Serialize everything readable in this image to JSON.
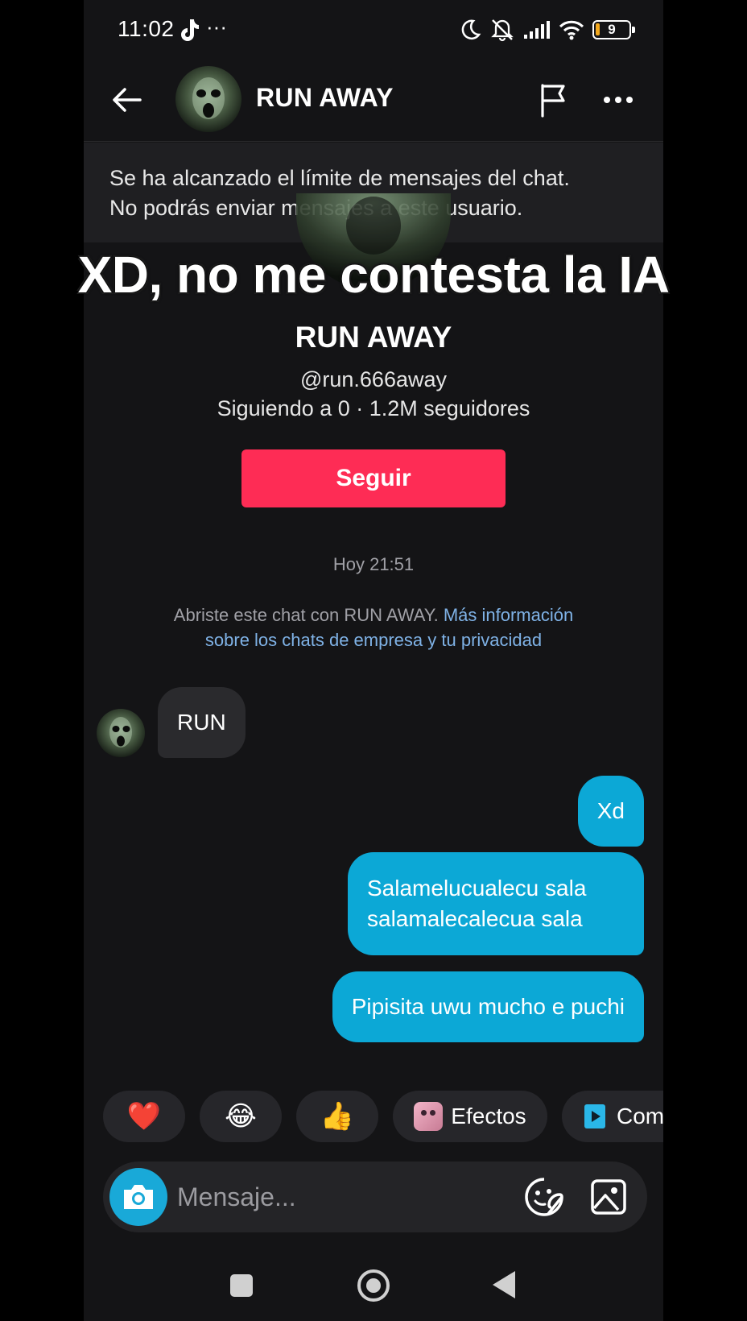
{
  "status_bar": {
    "time": "11:02",
    "dots": "···",
    "battery": "9",
    "icons": [
      "moon-icon",
      "mute-icon",
      "signal-icon",
      "wifi-icon",
      "battery-icon"
    ]
  },
  "header": {
    "title": "RUN AWAY"
  },
  "banner": {
    "line1": "Se ha alcanzado el límite de mensajes del chat.",
    "line2": "No podrás enviar mensajes a este usuario."
  },
  "profile": {
    "name": "RUN AWAY",
    "handle": "@run.666away",
    "stats": "Siguiendo a 0 · 1.2M seguidores",
    "follow_label": "Seguir"
  },
  "chat": {
    "timestamp": "Hoy 21:51",
    "info_prefix": "Abriste este chat con RUN AWAY. ",
    "info_link": "Más información sobre los chats de empresa y tu privacidad",
    "messages": [
      {
        "from": "them",
        "text": "RUN"
      },
      {
        "from": "me",
        "text": "Xd"
      },
      {
        "from": "me",
        "text": "Salamelucualecu sala salamalecalecua sala"
      },
      {
        "from": "me",
        "text": "Pipisita uwu mucho e puchi"
      }
    ]
  },
  "quick_replies": {
    "heart": "❤️",
    "laugh": "😂",
    "thumbs": "👍",
    "effects": "Efectos",
    "com": "Com"
  },
  "composer": {
    "placeholder": "Mensaje..."
  },
  "overlay": {
    "caption": "XD, no me contesta la IA"
  },
  "colors": {
    "accent_follow": "#fe2c55",
    "bubble_out": "#0ca8d6",
    "bubble_in": "#2a2a2d",
    "link": "#7fb2e6"
  }
}
